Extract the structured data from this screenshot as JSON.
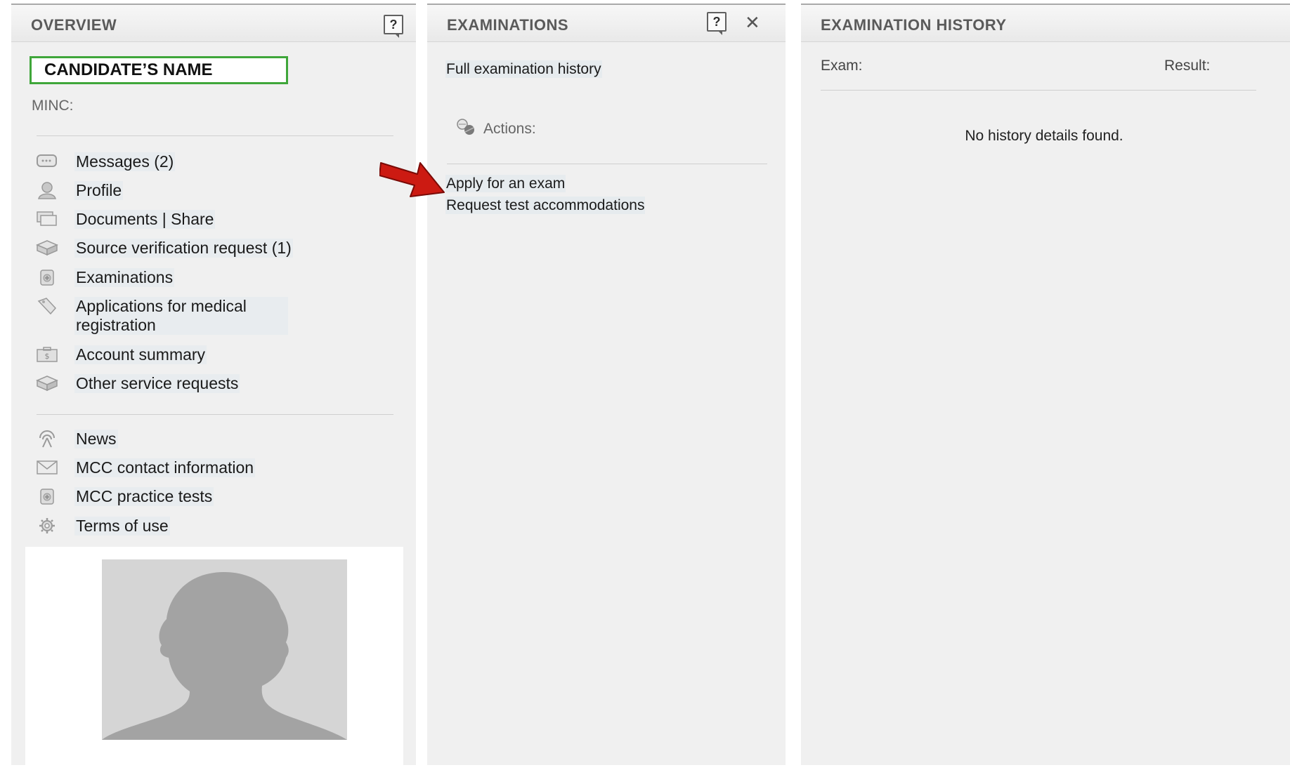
{
  "overview": {
    "title": "OVERVIEW",
    "help_label": "?",
    "candidate_name": "CANDIDATE’S NAME",
    "minc_label": "MINC:",
    "nav_primary": [
      {
        "label": "Messages (2)",
        "icon": "messages-icon"
      },
      {
        "label": "Profile",
        "icon": "profile-icon"
      },
      {
        "label": "Documents | Share",
        "icon": "documents-icon"
      },
      {
        "label": "Source verification request (1)",
        "icon": "verification-icon"
      },
      {
        "label": "Examinations",
        "icon": "examinations-icon"
      },
      {
        "label": "Applications for medical registration",
        "icon": "applications-icon"
      },
      {
        "label": "Account summary",
        "icon": "account-icon"
      },
      {
        "label": "Other service requests",
        "icon": "service-requests-icon"
      }
    ],
    "nav_secondary": [
      {
        "label": "News",
        "icon": "news-icon"
      },
      {
        "label": "MCC contact information",
        "icon": "envelope-icon"
      },
      {
        "label": "MCC practice tests",
        "icon": "practice-tests-icon"
      },
      {
        "label": "Terms of use",
        "icon": "gear-icon"
      }
    ]
  },
  "examinations": {
    "title": "EXAMINATIONS",
    "help_label": "?",
    "close_label": "✕",
    "full_history_link": "Full examination history",
    "actions_label": "Actions:",
    "action_links": [
      "Apply for an exam",
      "Request test accommodations"
    ]
  },
  "history": {
    "title": "EXAMINATION HISTORY",
    "exam_col": "Exam:",
    "result_col": "Result:",
    "empty_message": "No history details found."
  },
  "colors": {
    "highlight_border": "#3fa63a",
    "arrow": "#cc1a12",
    "panel_bg": "#f0f0f0"
  }
}
